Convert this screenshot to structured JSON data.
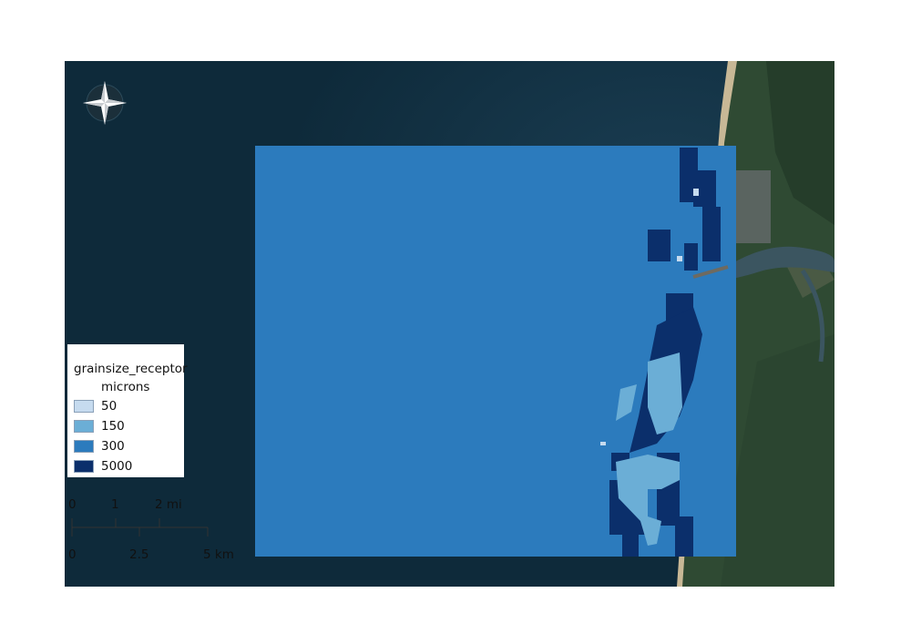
{
  "legend": {
    "title": "grainsize_receptor",
    "units": "microns",
    "items": [
      {
        "label": "50",
        "color": "#c6dbef"
      },
      {
        "label": "150",
        "color": "#6baed6"
      },
      {
        "label": "300",
        "color": "#2c7bbd"
      },
      {
        "label": "5000",
        "color": "#0b2f6b"
      }
    ]
  },
  "scalebar": {
    "miles_labels": [
      "0",
      "1",
      "2 mi"
    ],
    "km_labels": [
      "0",
      "2.5",
      "5 km"
    ]
  },
  "map": {
    "north_arrow": "compass-rose-icon",
    "colors": {
      "ocean": "#0e2a3a",
      "land": "#2f4a33",
      "beach": "#c8b896",
      "raster_300": "#2c7bbd",
      "raster_5000": "#0b2f6b",
      "raster_150": "#6baed6",
      "raster_50": "#c6dbef"
    }
  }
}
